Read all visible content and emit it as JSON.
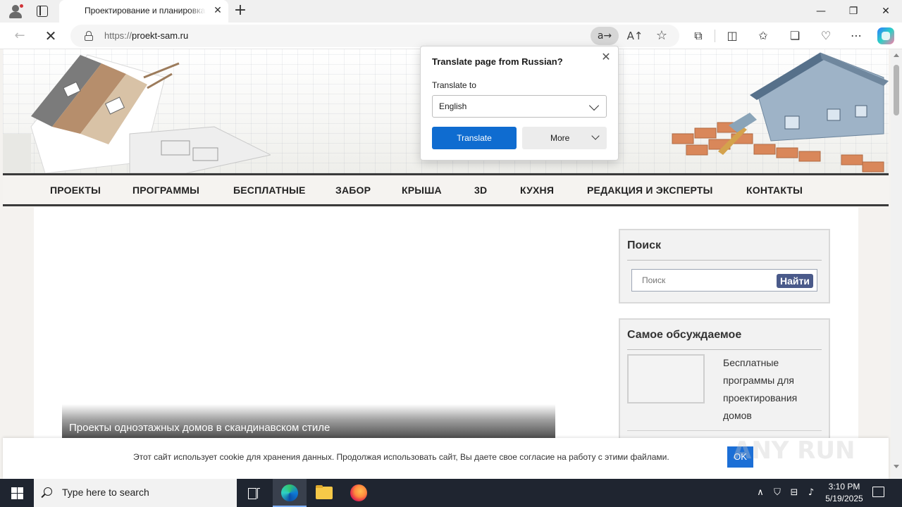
{
  "browser": {
    "tab_title": "Проектирование и планировка",
    "tab_close": "✕",
    "new_tab": "+",
    "url_protocol": "https://",
    "url_host": "proekt-sam.ru",
    "window_controls": {
      "minimize": "—",
      "maximize": "❐",
      "close": "✕"
    },
    "translate_indicator": "a→",
    "read_aloud": "A↑",
    "favorite": "☆"
  },
  "site": {
    "nav": [
      "ПРОЕКТЫ",
      "ПРОГРАММЫ",
      "БЕСПЛАТНЫЕ",
      "ЗАБОР",
      "КРЫША",
      "3D",
      "КУХНЯ",
      "РЕДАКЦИЯ И ЭКСПЕРТЫ",
      "КОНТАКТЫ"
    ],
    "featured_caption": "Проекты одноэтажных домов в скандинавском стиле",
    "search_widget": {
      "title": "Поиск",
      "placeholder": "Поиск",
      "button": "Найти"
    },
    "popular_widget": {
      "title": "Самое обсуждаемое",
      "item_text": "Бесплатные программы для проектирования домов"
    },
    "cookie": {
      "text": "Этот сайт использует cookie для хранения данных. Продолжая использовать сайт, Вы даете свое согласие на работу с этими файлами.",
      "ok": "OK"
    },
    "watermark": "ANY RUN"
  },
  "translate_popup": {
    "title": "Translate page from Russian?",
    "translate_to_label": "Translate to",
    "selected_language": "English",
    "translate_button": "Translate",
    "more_button": "More",
    "close": "✕"
  },
  "taskbar": {
    "search_placeholder": "Type here to search",
    "time": "3:10 PM",
    "date": "5/19/2025"
  }
}
